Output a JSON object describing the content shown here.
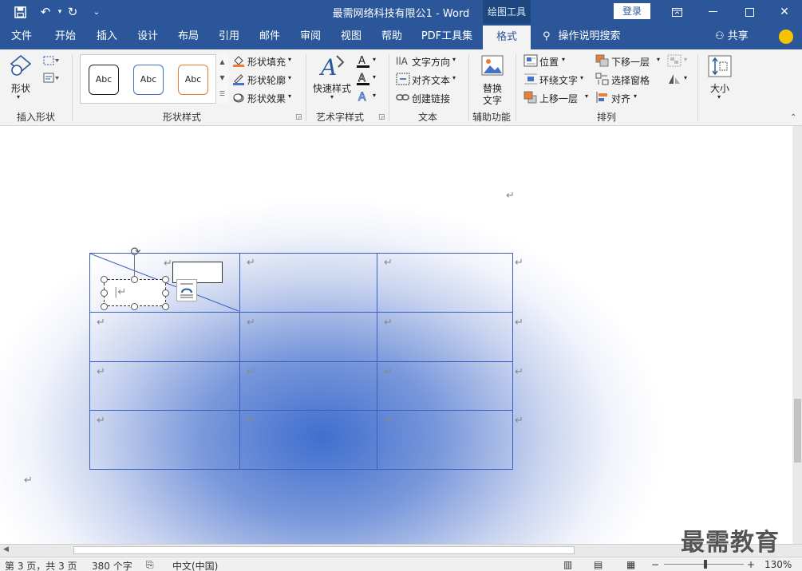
{
  "app": {
    "title": "最需网络科技有限公1  -  Word",
    "context_tab": "绘图工具",
    "login": "登录"
  },
  "quick_access": {
    "save_icon": "save-icon",
    "undo_icon": "undo-icon",
    "redo_icon": "redo-icon"
  },
  "tabs": [
    "文件",
    "开始",
    "插入",
    "设计",
    "布局",
    "引用",
    "邮件",
    "审阅",
    "视图",
    "帮助",
    "PDF工具集",
    "格式"
  ],
  "active_tab": "格式",
  "tell_me": "操作说明搜索",
  "share": "共享",
  "ribbon": {
    "insert_shapes": {
      "label": "插入形状",
      "shapes_button": "形状"
    },
    "shape_styles": {
      "label": "形状样式",
      "swatches": [
        "Abc",
        "Abc",
        "Abc"
      ],
      "swatch_colors": [
        "#222222",
        "#4472c4",
        "#ed7d31"
      ],
      "fill": "形状填充",
      "outline": "形状轮廓",
      "effects": "形状效果"
    },
    "wordart": {
      "label": "艺术字样式",
      "quick_styles": "快速样式"
    },
    "text": {
      "label": "文本",
      "direction": "文字方向",
      "align": "对齐文本",
      "link": "创建链接"
    },
    "accessibility": {
      "label": "辅助功能",
      "alt_text_1": "替换",
      "alt_text_2": "文字"
    },
    "arrange": {
      "label": "排列",
      "position": "位置",
      "wrap": "环绕文字",
      "forward": "上移一层",
      "backward": "下移一层",
      "pane": "选择窗格",
      "align": "对齐"
    },
    "size": {
      "label": "大小"
    }
  },
  "status": {
    "page": "第 3 页，共 3 页",
    "words": "380 个字",
    "lang": "中文(中国)",
    "zoom": "130%"
  },
  "watermark": "最需教育",
  "colors": {
    "brand": "#2b579a",
    "table_border": "#3b5fbf"
  }
}
